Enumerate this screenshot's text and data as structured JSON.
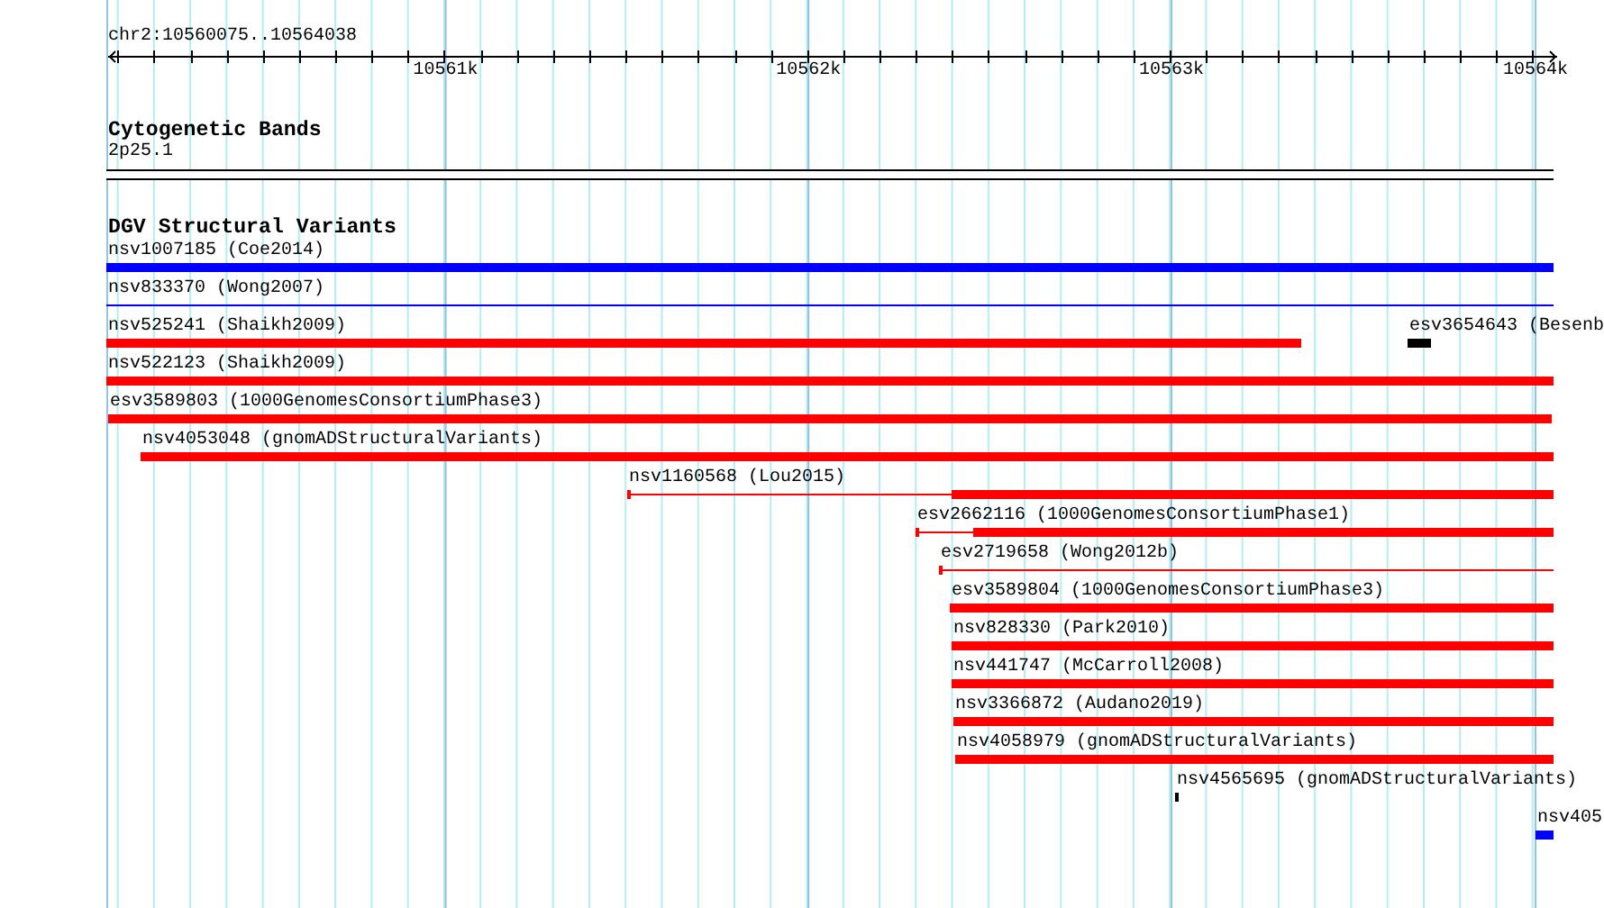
{
  "ruler": {
    "location": "chr2:10560075..10564038",
    "tick_labels": [
      "10561k",
      "10562k",
      "10563k",
      "10564k"
    ]
  },
  "cytogenetic_track": {
    "title": "Cytogenetic Bands",
    "band": "2p25.1"
  },
  "dgv_track": {
    "title": "DGV Structural Variants",
    "rows": [
      {
        "features": [
          {
            "label": "nsv1007185 (Coe2014)",
            "color": "#0000ff",
            "kind": "bar"
          }
        ]
      },
      {
        "features": [
          {
            "label": "nsv833370 (Wong2007)",
            "color": "#0000ff",
            "kind": "line"
          }
        ]
      },
      {
        "features": [
          {
            "label": "nsv525241 (Shaikh2009)",
            "color": "#ff0000",
            "kind": "bar"
          },
          {
            "label": "esv3654643 (Besenb",
            "color": "#000000",
            "kind": "bar"
          }
        ]
      },
      {
        "features": [
          {
            "label": "nsv522123 (Shaikh2009)",
            "color": "#ff0000",
            "kind": "bar"
          }
        ]
      },
      {
        "features": [
          {
            "label": "esv3589803 (1000GenomesConsortiumPhase3)",
            "color": "#ff0000",
            "kind": "bar"
          }
        ]
      },
      {
        "features": [
          {
            "label": "nsv4053048 (gnomADStructuralVariants)",
            "color": "#ff0000",
            "kind": "bar"
          }
        ]
      },
      {
        "features": [
          {
            "label": "nsv1160568 (Lou2015)",
            "color": "#ff0000",
            "kind": "line-bar"
          }
        ]
      },
      {
        "features": [
          {
            "label": "esv2662116 (1000GenomesConsortiumPhase1)",
            "color": "#ff0000",
            "kind": "line-bar"
          }
        ]
      },
      {
        "features": [
          {
            "label": "esv2719658 (Wong2012b)",
            "color": "#ff0000",
            "kind": "line"
          }
        ]
      },
      {
        "features": [
          {
            "label": "esv3589804 (1000GenomesConsortiumPhase3)",
            "color": "#ff0000",
            "kind": "bar"
          }
        ]
      },
      {
        "features": [
          {
            "label": "nsv828330 (Park2010)",
            "color": "#ff0000",
            "kind": "bar"
          }
        ]
      },
      {
        "features": [
          {
            "label": "nsv441747 (McCarroll2008)",
            "color": "#ff0000",
            "kind": "bar"
          }
        ]
      },
      {
        "features": [
          {
            "label": "nsv3366872 (Audano2019)",
            "color": "#ff0000",
            "kind": "bar"
          }
        ]
      },
      {
        "features": [
          {
            "label": "nsv4058979 (gnomADStructuralVariants)",
            "color": "#ff0000",
            "kind": "bar"
          }
        ]
      },
      {
        "features": [
          {
            "label": "nsv4565695 (gnomADStructuralVariants)",
            "color": "#000000",
            "kind": "bar"
          }
        ]
      },
      {
        "features": [
          {
            "label": "nsv405",
            "color": "#0000ff",
            "kind": "bar"
          }
        ]
      }
    ]
  }
}
